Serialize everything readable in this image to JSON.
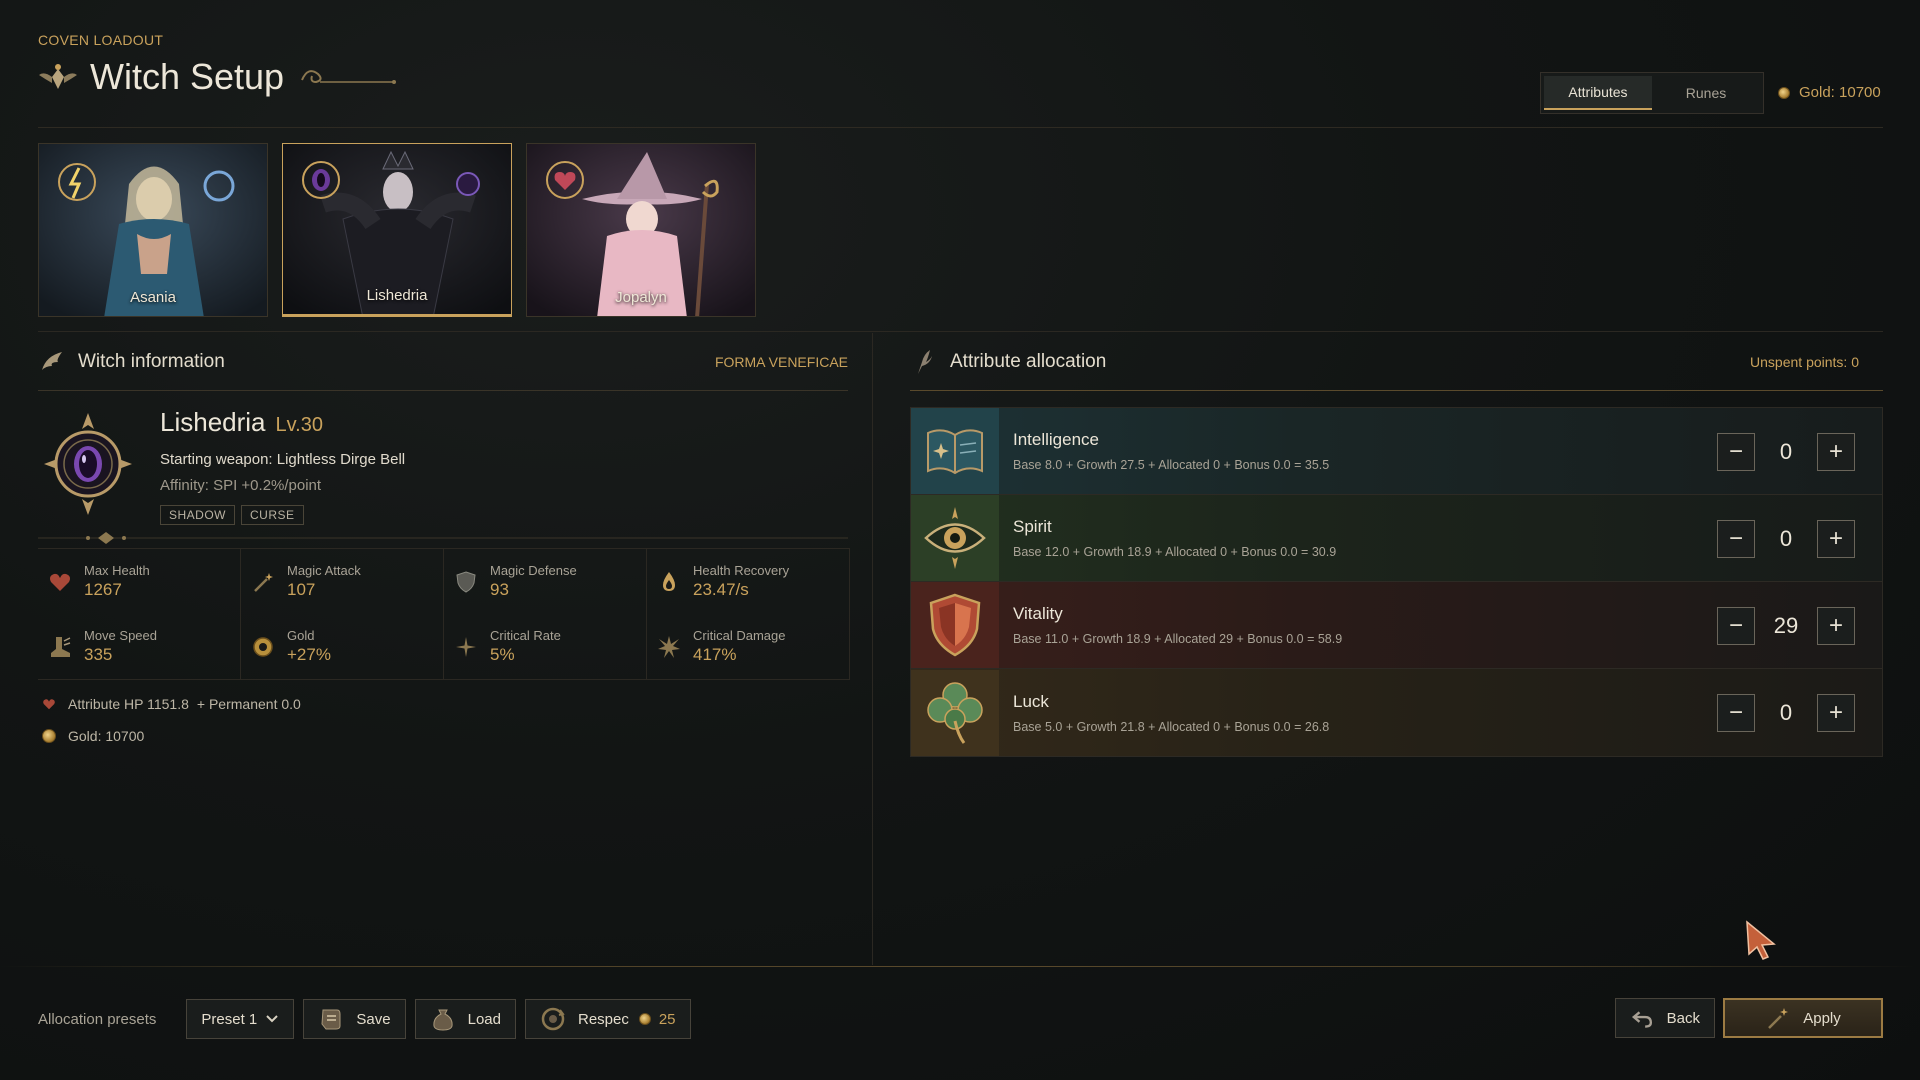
{
  "header": {
    "eyebrow": "COVEN LOADOUT",
    "title": "Witch Setup",
    "tabs": [
      {
        "label": "Attributes",
        "active": true
      },
      {
        "label": "Runes",
        "active": false
      }
    ],
    "gold": "Gold: 10700"
  },
  "portraits": [
    {
      "name": "Asania",
      "selected": false,
      "crest_icon": "lightning-crest-icon"
    },
    {
      "name": "Lishedria",
      "selected": true,
      "crest_icon": "void-eye-crest-icon"
    },
    {
      "name": "Jopalyn",
      "selected": false,
      "crest_icon": "heart-crest-icon"
    }
  ],
  "witch_info": {
    "title": "Witch information",
    "form_label": "FORMA VENEFICAE",
    "name": "Lishedria",
    "level": "Lv.30",
    "weapon": "Starting weapon: Lightless Dirge Bell",
    "affinity": "Affinity: SPI +0.2%/point",
    "tags": [
      "SHADOW",
      "CURSE"
    ],
    "stats": [
      {
        "label": "Max Health",
        "value": "1267",
        "icon": "heart-icon"
      },
      {
        "label": "Magic Attack",
        "value": "107",
        "icon": "wand-icon"
      },
      {
        "label": "Magic Defense",
        "value": "93",
        "icon": "shield-icon"
      },
      {
        "label": "Health Recovery",
        "value": "23.47/s",
        "icon": "flame-drop-icon"
      },
      {
        "label": "Move Speed",
        "value": "335",
        "icon": "boot-icon"
      },
      {
        "label": "Gold",
        "value": "+27%",
        "icon": "coin-icon"
      },
      {
        "label": "Critical Rate",
        "value": "5%",
        "icon": "sparkle-icon"
      },
      {
        "label": "Critical Damage",
        "value": "417%",
        "icon": "burst-icon"
      }
    ],
    "attribute_hp": "Attribute HP 1151.8",
    "permanent": "+ Permanent 0.0",
    "gold_line": "Gold: 10700"
  },
  "attributes": {
    "title": "Attribute allocation",
    "unspent": "Unspent points: 0",
    "rows": [
      {
        "name": "Intelligence",
        "formula": "Base 8.0  + Growth 27.5  + Allocated 0  + Bonus 0.0  =  35.5",
        "allocated": "0",
        "icon": "book-icon"
      },
      {
        "name": "Spirit",
        "formula": "Base 12.0  + Growth 18.9  + Allocated 0  + Bonus 0.0  =  30.9",
        "allocated": "0",
        "icon": "eye-icon"
      },
      {
        "name": "Vitality",
        "formula": "Base 11.0  + Growth 18.9  + Allocated 29  + Bonus 0.0  =  58.9",
        "allocated": "29",
        "icon": "shield-icon"
      },
      {
        "name": "Luck",
        "formula": "Base 5.0  + Growth 21.8  + Allocated 0  + Bonus 0.0  =  26.8",
        "allocated": "0",
        "icon": "clover-icon"
      }
    ],
    "minus": "−",
    "plus": "+"
  },
  "footer": {
    "presets_label": "Allocation presets",
    "preset_value": "Preset 1",
    "save": "Save",
    "load": "Load",
    "respec": "Respec",
    "respec_cost": "25",
    "back": "Back",
    "apply": "Apply"
  },
  "colors": {
    "accent_gold": "#c9a25c",
    "background": "#121514",
    "intelligence": "#22434a",
    "spirit": "#2c3f26",
    "vitality": "#4a231d",
    "luck": "#3f321d"
  }
}
